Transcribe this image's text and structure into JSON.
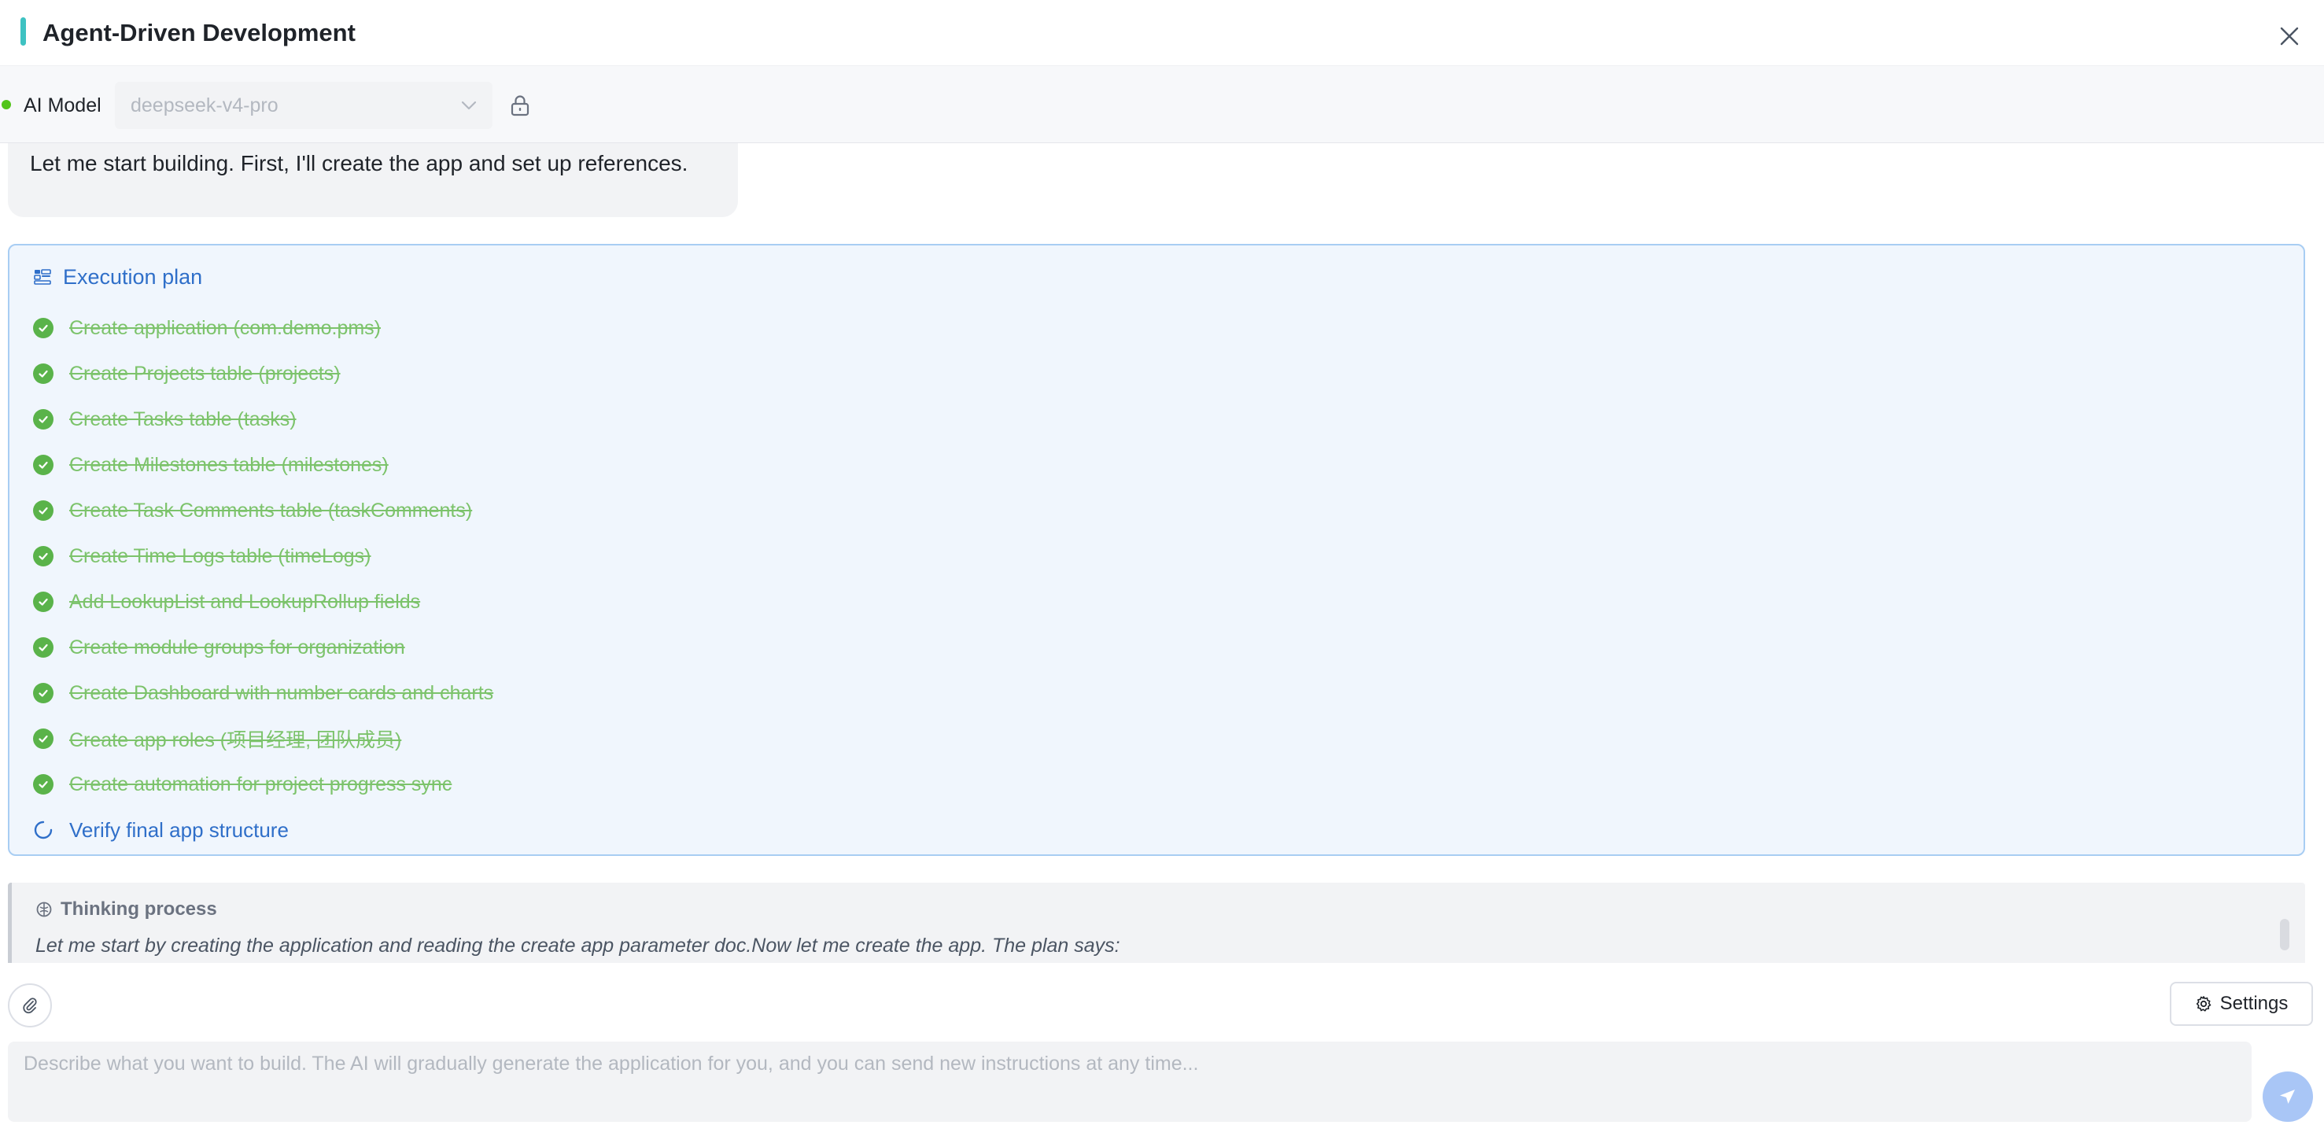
{
  "header": {
    "title": "Agent-Driven Development",
    "accent_color": "#3ec2c2",
    "close_icon": "close-icon"
  },
  "model_bar": {
    "status_color": "#52c41a",
    "label": "AI Model",
    "selected_model": "deepseek-v4-pro",
    "lock_icon": "lock-icon"
  },
  "conversation": {
    "assistant_message": "Let me start building. First, I'll create the app and set up references.",
    "plan": {
      "title": "Execution plan",
      "icon": "plan-icon",
      "accent_color": "#2f6fc9",
      "done_color": "#5ab34a",
      "steps": [
        {
          "label": "Create application (com.demo.pms)",
          "status": "done"
        },
        {
          "label": "Create Projects table (projects)",
          "status": "done"
        },
        {
          "label": "Create Tasks table (tasks)",
          "status": "done"
        },
        {
          "label": "Create Milestones table (milestones)",
          "status": "done"
        },
        {
          "label": "Create Task Comments table (taskComments)",
          "status": "done"
        },
        {
          "label": "Create Time Logs table (timeLogs)",
          "status": "done"
        },
        {
          "label": "Add LookupList and LookupRollup fields",
          "status": "done"
        },
        {
          "label": "Create module groups for organization",
          "status": "done"
        },
        {
          "label": "Create Dashboard with number cards and charts",
          "status": "done"
        },
        {
          "label": "Create app roles (项目经理, 团队成员)",
          "status": "done"
        },
        {
          "label": "Create automation for project progress sync",
          "status": "done"
        },
        {
          "label": "Verify final app structure",
          "status": "in-progress"
        }
      ]
    },
    "thinking": {
      "title": "Thinking process",
      "icon": "brain-icon",
      "text": "Let me start by creating the application and reading the create app parameter doc.Now let me create the app. The plan says:"
    }
  },
  "composer": {
    "attach_icon": "paperclip-icon",
    "settings_label": "Settings",
    "settings_icon": "gear-icon",
    "placeholder": "Describe what you want to build. The AI will gradually generate the application for you, and you can send new instructions at any time...",
    "value": "",
    "send_icon": "send-icon",
    "send_color": "#a9c6f6"
  }
}
